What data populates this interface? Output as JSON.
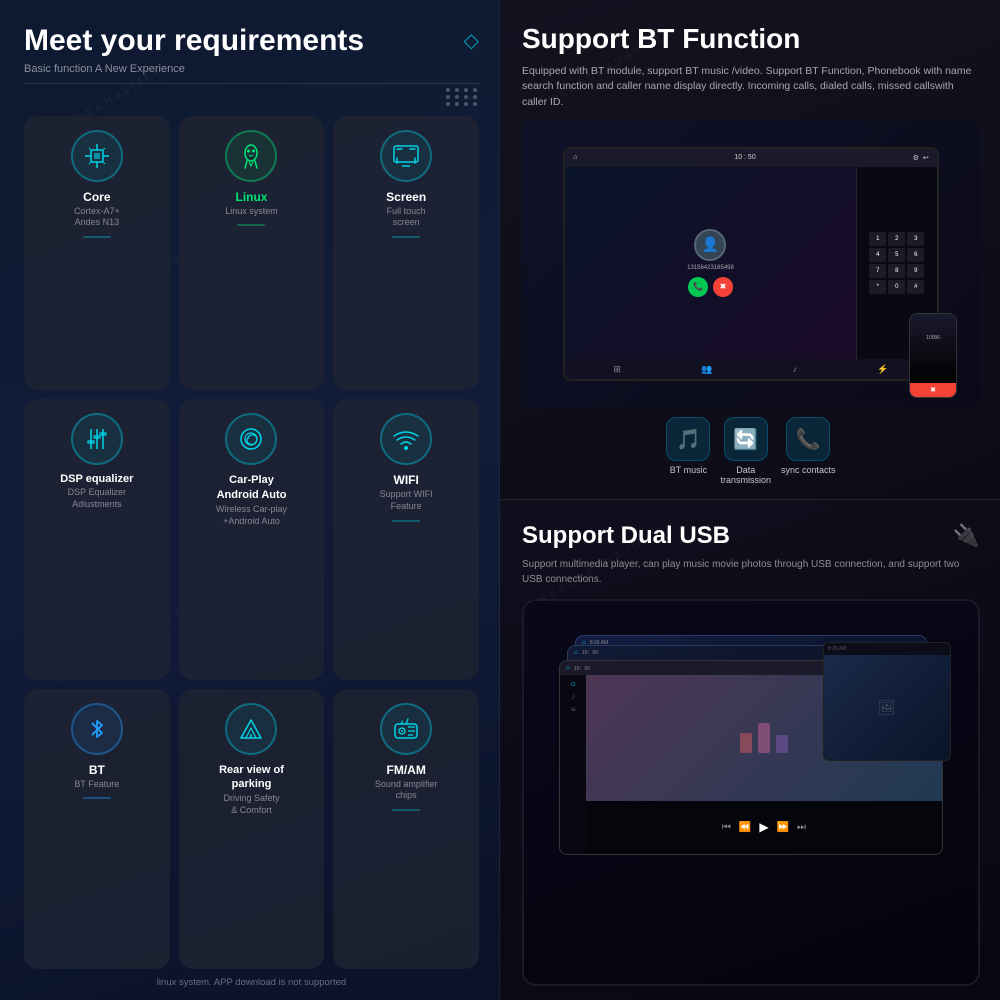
{
  "left_panel": {
    "title": "Meet your requirements",
    "subtitle": "Basic function A New Experience",
    "features": [
      {
        "id": "core",
        "name": "Core",
        "desc": "Cortex-A7+\nAndes N13",
        "icon": "⬡",
        "name_class": ""
      },
      {
        "id": "linux",
        "name": "Linux",
        "desc": "Linux system",
        "icon": "🤖",
        "name_class": "linux"
      },
      {
        "id": "screen",
        "name": "Screen",
        "desc": "Full touch screen",
        "icon": "⬚",
        "name_class": ""
      },
      {
        "id": "dsp",
        "name": "DSP equalizer",
        "desc": "DSP Equalizer\nAdiustments",
        "icon": "⊟",
        "name_class": ""
      },
      {
        "id": "carplay",
        "name": "Car-Play\nAndroid Auto",
        "desc": "Wireless Car-play\n+Android Auto",
        "icon": "©",
        "name_class": ""
      },
      {
        "id": "wifi",
        "name": "WIFI",
        "desc": "Support WIFI\nFeature",
        "icon": "📶",
        "name_class": ""
      },
      {
        "id": "bt",
        "name": "BT",
        "desc": "BT Feature",
        "icon": "⚡",
        "name_class": "bt"
      },
      {
        "id": "parking",
        "name": "Rear view of\nparking",
        "desc": "Driving Safety\n& Comfort",
        "icon": "△",
        "name_class": ""
      },
      {
        "id": "fmam",
        "name": "FM/AM",
        "desc": "Sound amplifier\nchips",
        "icon": "📻",
        "name_class": ""
      }
    ],
    "footer": "linux system. APP download is not supported"
  },
  "right_top_panel": {
    "title": "Support BT\nFunction",
    "description": "Equipped with BT module, support BT music /video. Support BT Function, Phonebook with name search function and caller name display directly. Incoming calls, dialed calls, missed callswith caller ID.",
    "caller_number": "13156423165498",
    "bt_features": [
      {
        "label": "BT music",
        "icon": "🎵"
      },
      {
        "label": "Data\ntransmission",
        "icon": "🔄"
      },
      {
        "label": "sync\ncontacts",
        "icon": "📞"
      }
    ],
    "numpad_keys": [
      "1",
      "2",
      "3",
      "4",
      "5",
      "6",
      "7",
      "8",
      "9",
      "*",
      "0",
      "#"
    ]
  },
  "right_bottom_panel": {
    "title": "Support Dual USB",
    "description": "Support multimedia player, can play music movie photos through USB connection, and support two USB connections.",
    "time1": "8:26 AM",
    "time2": "10：50"
  },
  "watermark_text": "MEKEDE&NAVIFLY"
}
